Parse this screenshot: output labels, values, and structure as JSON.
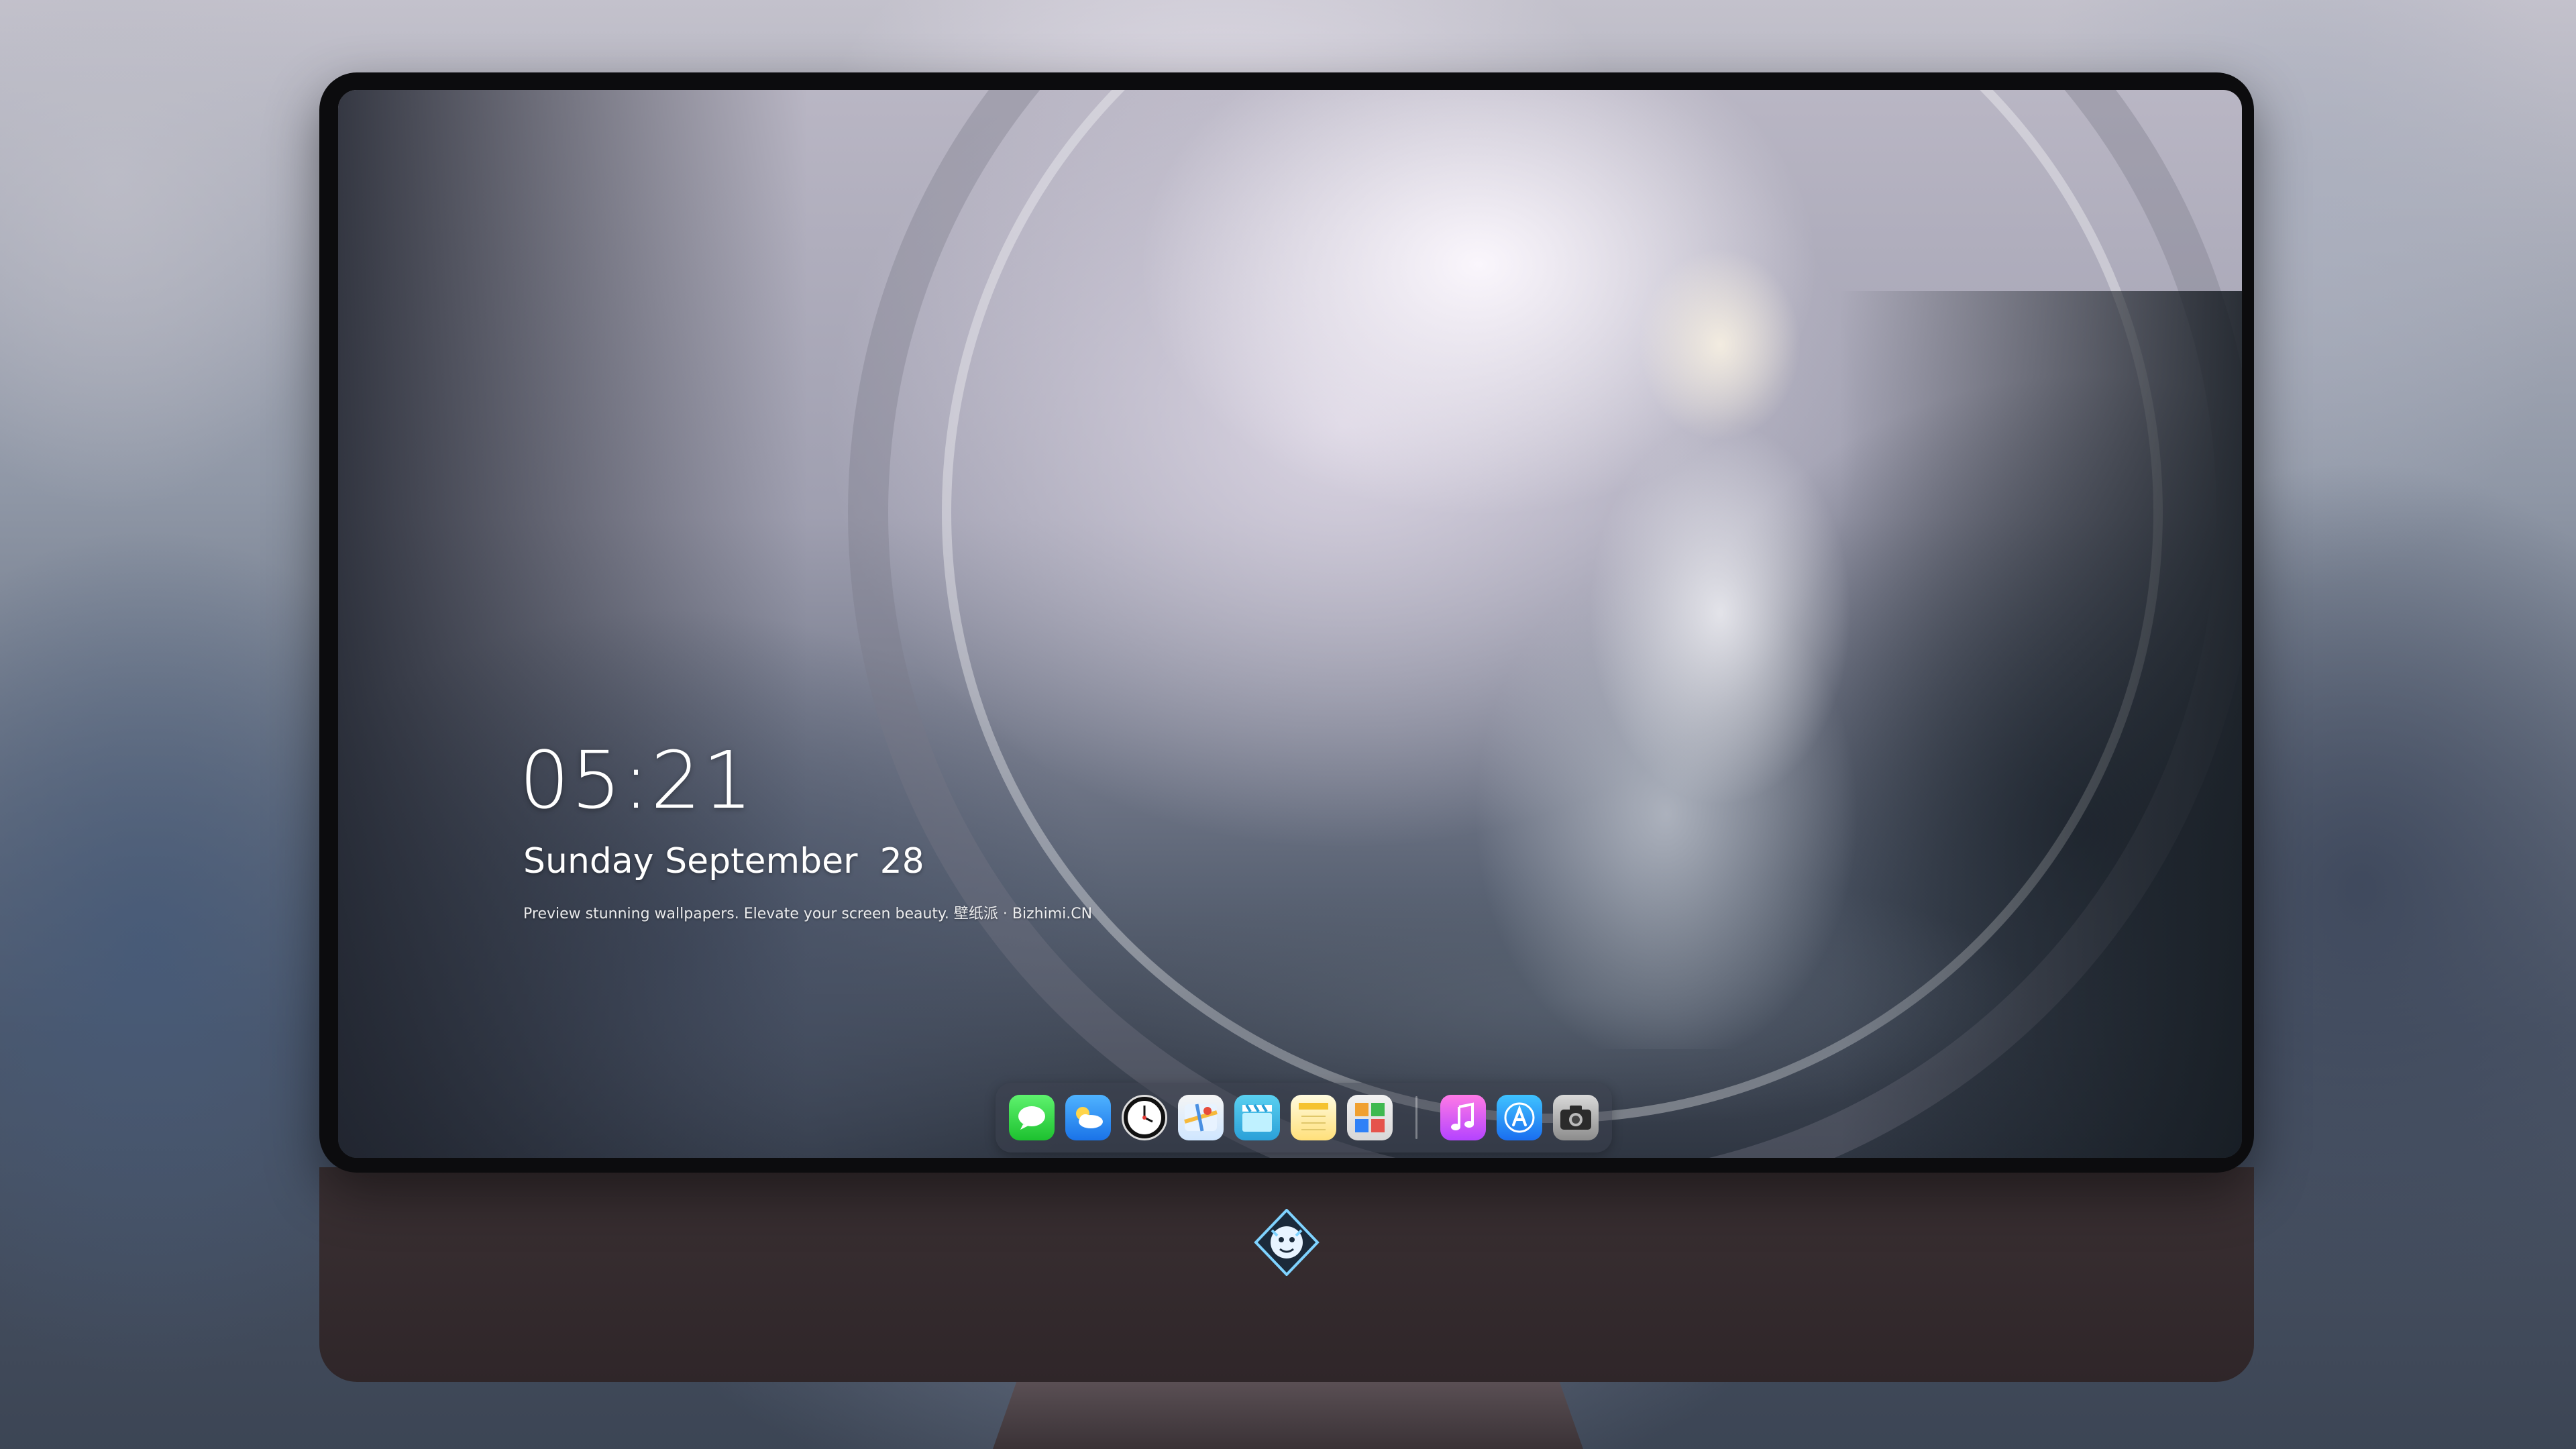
{
  "lockscreen": {
    "time": "05:21",
    "date": "Sunday September  28",
    "caption": "Preview stunning wallpapers. Elevate your screen beauty. 壁纸派 · Bizhimi.CN"
  },
  "dock": {
    "apps": [
      {
        "name": "messages-icon",
        "glyph": "💬"
      },
      {
        "name": "weather-icon",
        "glyph": "☁"
      },
      {
        "name": "clock-icon",
        "glyph": "🕓"
      },
      {
        "name": "maps-icon",
        "glyph": "🗺"
      },
      {
        "name": "clips-icon",
        "glyph": "🎬"
      },
      {
        "name": "notes-icon",
        "glyph": "▤"
      },
      {
        "name": "photos-icon",
        "glyph": "▦"
      }
    ],
    "apps_right": [
      {
        "name": "music-icon",
        "glyph": "♫"
      },
      {
        "name": "app-store-icon",
        "glyph": "A"
      },
      {
        "name": "camera-icon",
        "glyph": "📷"
      }
    ]
  },
  "colors": {
    "bezel": "#0c0c0e",
    "chin": "#3a3033",
    "text": "#ffffff"
  }
}
